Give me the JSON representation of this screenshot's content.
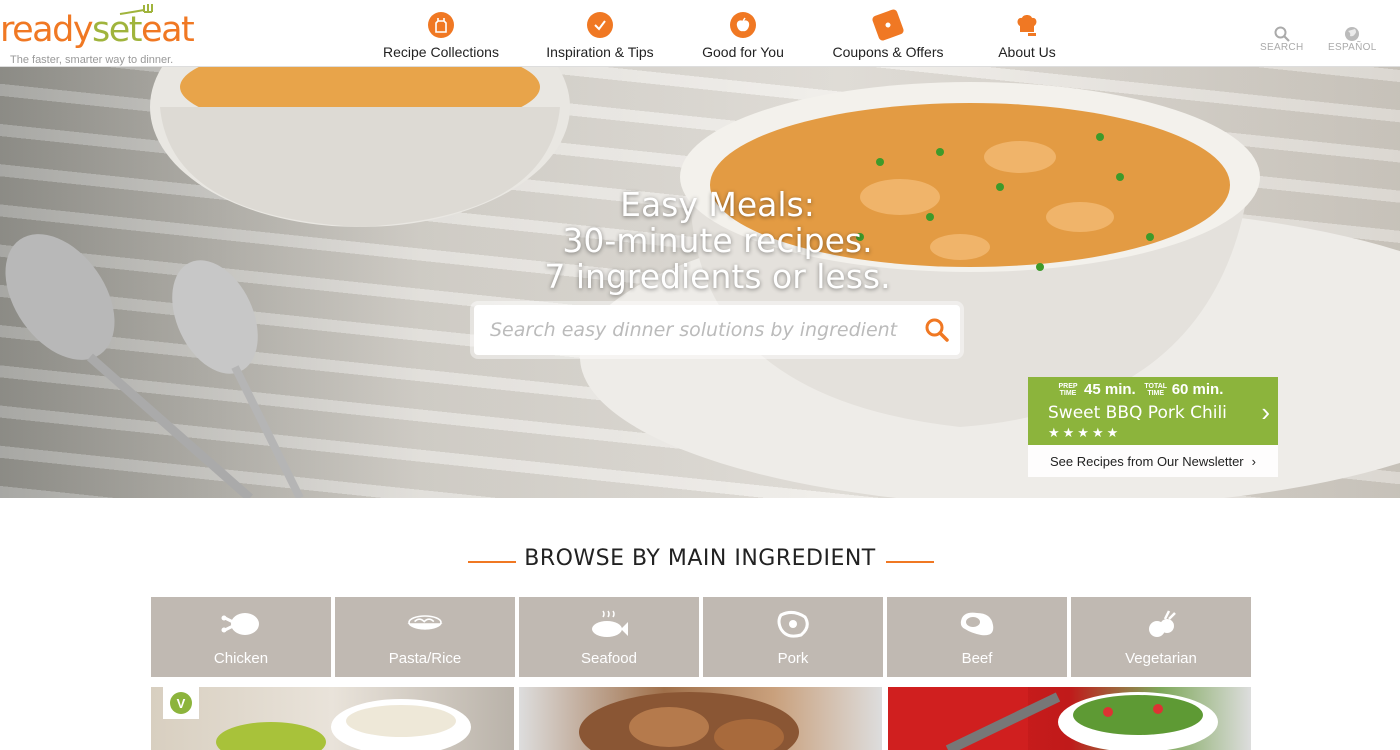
{
  "brand": {
    "logo_ready": "ready",
    "logo_set": "set",
    "logo_eat": "eat",
    "tagline": "The faster, smarter way to dinner."
  },
  "nav": [
    {
      "label": "Recipe Collections",
      "icon": "apron-icon"
    },
    {
      "label": "Inspiration & Tips",
      "icon": "checkmark-icon"
    },
    {
      "label": "Good for You",
      "icon": "apple-icon"
    },
    {
      "label": "Coupons & Offers",
      "icon": "tag-icon"
    },
    {
      "label": "About Us",
      "icon": "chef-hat-icon"
    }
  ],
  "utility": {
    "search_label": "SEARCH",
    "language_label": "ESPAÑOL"
  },
  "hero": {
    "line1": "Easy Meals:",
    "line2": "30-minute recipes.",
    "line3": "7 ingredients or less.",
    "search_placeholder": "Search easy dinner solutions by ingredient"
  },
  "promo": {
    "prep_label": "PREP TIME",
    "prep_value": "45 min.",
    "total_label": "TOTAL TIME",
    "total_value": "60 min.",
    "name": "Sweet BBQ Pork Chili",
    "stars": "★★★★★",
    "newsletter_label": "See Recipes from Our Newsletter"
  },
  "browse": {
    "title": "BROWSE BY MAIN INGREDIENT",
    "categories": [
      "Chicken",
      "Pasta/Rice",
      "Seafood",
      "Pork",
      "Beef",
      "Vegetarian"
    ]
  },
  "colors": {
    "accent": "#f07823",
    "green": "#8cb43c",
    "category_bg": "#c0b9b2"
  }
}
